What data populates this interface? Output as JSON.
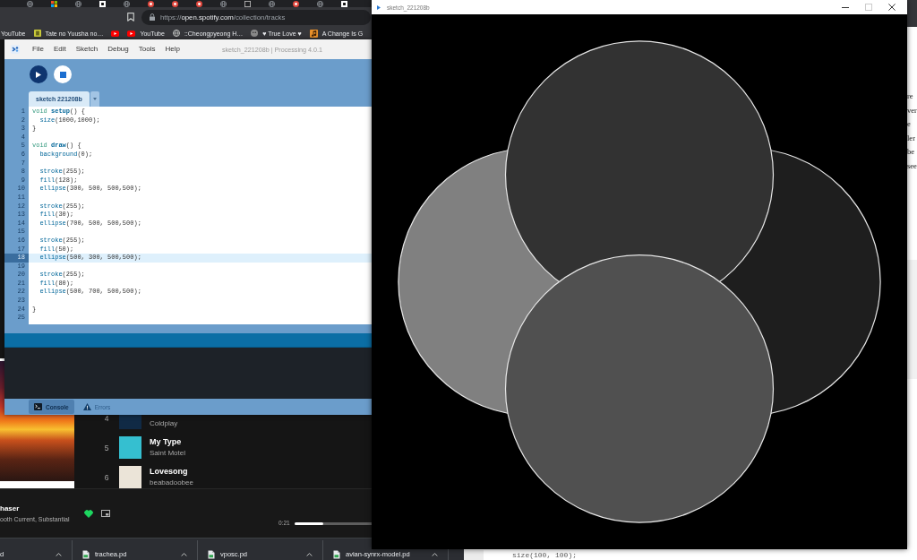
{
  "browser": {
    "address": {
      "scheme": "https://",
      "host": "open.spotify.com",
      "path": "/collection/tracks"
    },
    "bookmarks": [
      {
        "kind": "text",
        "label": "YouTube"
      },
      {
        "kind": "icon_text",
        "label": "Tate no Yuusha no…"
      },
      {
        "kind": "icon"
      },
      {
        "kind": "icon_text",
        "label": "YouTube"
      },
      {
        "kind": "icon_text",
        "label": "::Cheongpyeong H…"
      },
      {
        "kind": "icon_text",
        "label": "♥ True Love ♥"
      },
      {
        "kind": "icon_text",
        "label": "A Change Is G"
      }
    ]
  },
  "spotify": {
    "tracks": [
      {
        "number": "4",
        "artist": "Coldplay",
        "color": "#102a45"
      },
      {
        "number": "5",
        "title": "My Type",
        "artist": "Saint Motel",
        "color": "#35bfd0"
      },
      {
        "number": "6",
        "title": "Lovesong",
        "artist": "beabadoobee",
        "color": "#ebe4d8"
      }
    ],
    "player": {
      "title": "haser",
      "artist": "ooth Current, Substantial",
      "liked": true,
      "elapsed": "0:21",
      "level": 0.37
    }
  },
  "downloads": [
    {
      "kind": "partial",
      "name": "d"
    },
    {
      "kind": "file",
      "name": "trachea.pd"
    },
    {
      "kind": "file",
      "name": "vposc.pd"
    },
    {
      "kind": "file",
      "name": "avian-synrx-model.pd"
    }
  ],
  "editor": {
    "menus": [
      "File",
      "Edit",
      "Sketch",
      "Debug",
      "Tools",
      "Help"
    ],
    "title": "sketch_221208b | Processing 4.0.1",
    "tabs": [
      {
        "label": "sketch 221208b",
        "selected": true
      }
    ],
    "lines": [
      {
        "number": "1",
        "highlighted": false,
        "tokens": [
          {
            "kind": "keyword",
            "text": "void "
          },
          {
            "kind": "def",
            "text": "setup"
          },
          {
            "kind": "plain",
            "text": "() {"
          }
        ]
      },
      {
        "number": "2",
        "highlighted": false,
        "tokens": [
          {
            "kind": "call",
            "text": "  size"
          },
          {
            "kind": "plain",
            "text": "(1000,1000);"
          }
        ]
      },
      {
        "number": "3",
        "highlighted": false,
        "tokens": [
          {
            "kind": "plain",
            "text": "}"
          }
        ]
      },
      {
        "number": "4",
        "highlighted": false
      },
      {
        "number": "5",
        "highlighted": false,
        "tokens": [
          {
            "kind": "keyword",
            "text": "void "
          },
          {
            "kind": "def",
            "text": "draw"
          },
          {
            "kind": "plain",
            "text": "() {"
          }
        ]
      },
      {
        "number": "6",
        "highlighted": false,
        "tokens": [
          {
            "kind": "call",
            "text": "  background"
          },
          {
            "kind": "plain",
            "text": "(0);"
          }
        ]
      },
      {
        "number": "7",
        "highlighted": false
      },
      {
        "number": "8",
        "highlighted": false,
        "tokens": [
          {
            "kind": "call",
            "text": "  stroke"
          },
          {
            "kind": "plain",
            "text": "(255);"
          }
        ]
      },
      {
        "number": "9",
        "highlighted": false,
        "tokens": [
          {
            "kind": "call",
            "text": "  fill"
          },
          {
            "kind": "plain",
            "text": "(128);"
          }
        ]
      },
      {
        "number": "10",
        "highlighted": false,
        "tokens": [
          {
            "kind": "call",
            "text": "  ellipse"
          },
          {
            "kind": "plain",
            "text": "(300, 500, 500,500);"
          }
        ]
      },
      {
        "number": "11",
        "highlighted": false
      },
      {
        "number": "12",
        "highlighted": false,
        "tokens": [
          {
            "kind": "call",
            "text": "  stroke"
          },
          {
            "kind": "plain",
            "text": "(255);"
          }
        ]
      },
      {
        "number": "13",
        "highlighted": false,
        "tokens": [
          {
            "kind": "call",
            "text": "  fill"
          },
          {
            "kind": "plain",
            "text": "(30);"
          }
        ]
      },
      {
        "number": "14",
        "highlighted": false,
        "tokens": [
          {
            "kind": "call",
            "text": "  ellipse"
          },
          {
            "kind": "plain",
            "text": "(700, 500, 500,500);"
          }
        ]
      },
      {
        "number": "15",
        "highlighted": false
      },
      {
        "number": "16",
        "highlighted": false,
        "tokens": [
          {
            "kind": "call",
            "text": "  stroke"
          },
          {
            "kind": "plain",
            "text": "(255);"
          }
        ]
      },
      {
        "number": "17",
        "highlighted": false,
        "tokens": [
          {
            "kind": "call",
            "text": "  fill"
          },
          {
            "kind": "plain",
            "text": "(50);"
          }
        ]
      },
      {
        "number": "18",
        "highlighted": true,
        "tokens": [
          {
            "kind": "call",
            "text": "  ellipse"
          },
          {
            "kind": "plain",
            "text": "(500, 300, 500,500);"
          }
        ]
      },
      {
        "number": "19",
        "highlighted": false
      },
      {
        "number": "20",
        "highlighted": false,
        "tokens": [
          {
            "kind": "call",
            "text": "  stroke"
          },
          {
            "kind": "plain",
            "text": "(255);"
          }
        ]
      },
      {
        "number": "21",
        "highlighted": false,
        "tokens": [
          {
            "kind": "call",
            "text": "  fill"
          },
          {
            "kind": "plain",
            "text": "(80);"
          }
        ]
      },
      {
        "number": "22",
        "highlighted": false,
        "tokens": [
          {
            "kind": "call",
            "text": "  ellipse"
          },
          {
            "kind": "plain",
            "text": "(500, 700, 500,500);"
          }
        ]
      },
      {
        "number": "23",
        "highlighted": false
      },
      {
        "number": "24",
        "highlighted": false,
        "tokens": [
          {
            "kind": "plain",
            "text": "}"
          }
        ]
      },
      {
        "number": "25",
        "highlighted": false
      }
    ],
    "console_tabs": [
      {
        "label": "Console",
        "selected": true
      },
      {
        "label": "Errors",
        "selected": false
      }
    ]
  },
  "sketch_window": {
    "title": "sketch_221208b",
    "maximize_disabled": true
  },
  "background_page": {
    "fragments": [
      "re",
      "ver",
      "e",
      "ler",
      "be",
      "see"
    ],
    "code_line": "size(100, 100);"
  }
}
